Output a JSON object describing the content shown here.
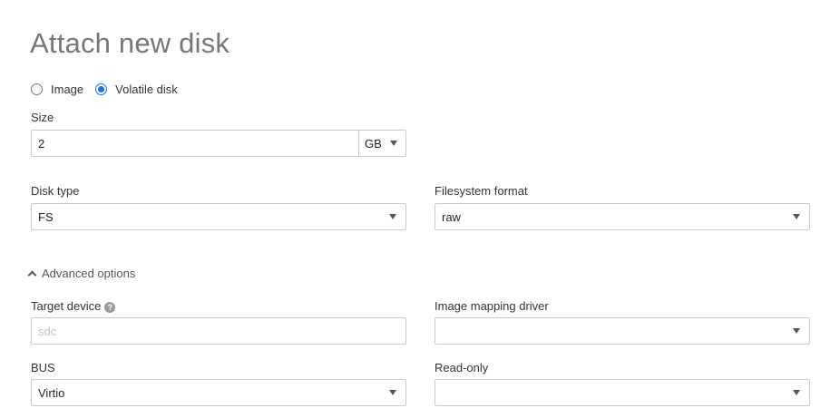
{
  "dialog": {
    "title": "Attach new disk"
  },
  "source": {
    "options": [
      {
        "label": "Image",
        "checked": false
      },
      {
        "label": "Volatile disk",
        "checked": true
      }
    ]
  },
  "size": {
    "label": "Size",
    "value": "2",
    "unit": "GB"
  },
  "disk_type": {
    "label": "Disk type",
    "value": "FS"
  },
  "filesystem_format": {
    "label": "Filesystem format",
    "value": "raw"
  },
  "advanced": {
    "label": "Advanced options",
    "expanded": true
  },
  "target_device": {
    "label": "Target device",
    "help_icon": "question-icon",
    "placeholder": "sdc",
    "value": ""
  },
  "image_mapping_driver": {
    "label": "Image mapping driver",
    "value": ""
  },
  "bus": {
    "label": "BUS",
    "value": "Virtio"
  },
  "read_only": {
    "label": "Read-only",
    "value": ""
  },
  "colors": {
    "accent": "#1a73e8",
    "title": "#777777",
    "border": "#cacaca"
  }
}
